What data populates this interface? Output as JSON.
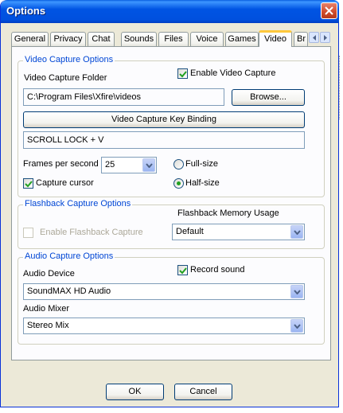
{
  "window": {
    "title": "Options"
  },
  "tabs": [
    {
      "label": "General"
    },
    {
      "label": "Privacy"
    },
    {
      "label": "Chat"
    },
    {
      "label": "Sounds"
    },
    {
      "label": "Files"
    },
    {
      "label": "Voice"
    },
    {
      "label": "Games"
    },
    {
      "label": "Video",
      "active": true
    },
    {
      "label": "Br"
    }
  ],
  "video": {
    "group_title": "Video Capture Options",
    "folder_label": "Video Capture Folder",
    "enable_label": "Enable Video Capture",
    "enable_checked": true,
    "folder_value": "C:\\Program Files\\Xfire\\videos",
    "browse_label": "Browse...",
    "keybinding_button": "Video Capture Key Binding",
    "keybinding_value": "SCROLL LOCK + V",
    "fps_label": "Frames per second",
    "fps_value": "25",
    "fullsize_label": "Full-size",
    "halfsize_label": "Half-size",
    "size_selected": "Half-size",
    "cursor_label": "Capture cursor",
    "cursor_checked": true
  },
  "flashback": {
    "group_title": "Flashback Capture Options",
    "enable_label": "Enable Flashback Capture",
    "enable_checked": false,
    "enable_disabled": true,
    "memory_label": "Flashback Memory Usage",
    "memory_value": "Default"
  },
  "audio": {
    "group_title": "Audio Capture Options",
    "record_label": "Record sound",
    "record_checked": true,
    "device_label": "Audio Device",
    "device_value": "SoundMAX HD Audio",
    "mixer_label": "Audio Mixer",
    "mixer_value": "Stereo Mix"
  },
  "buttons": {
    "ok": "OK",
    "cancel": "Cancel"
  },
  "colors": {
    "titlebar": "#0054e3",
    "group_title": "#0046d5",
    "dialog_bg": "#ece9d8",
    "active_tab_accent": "#ffc83c"
  }
}
